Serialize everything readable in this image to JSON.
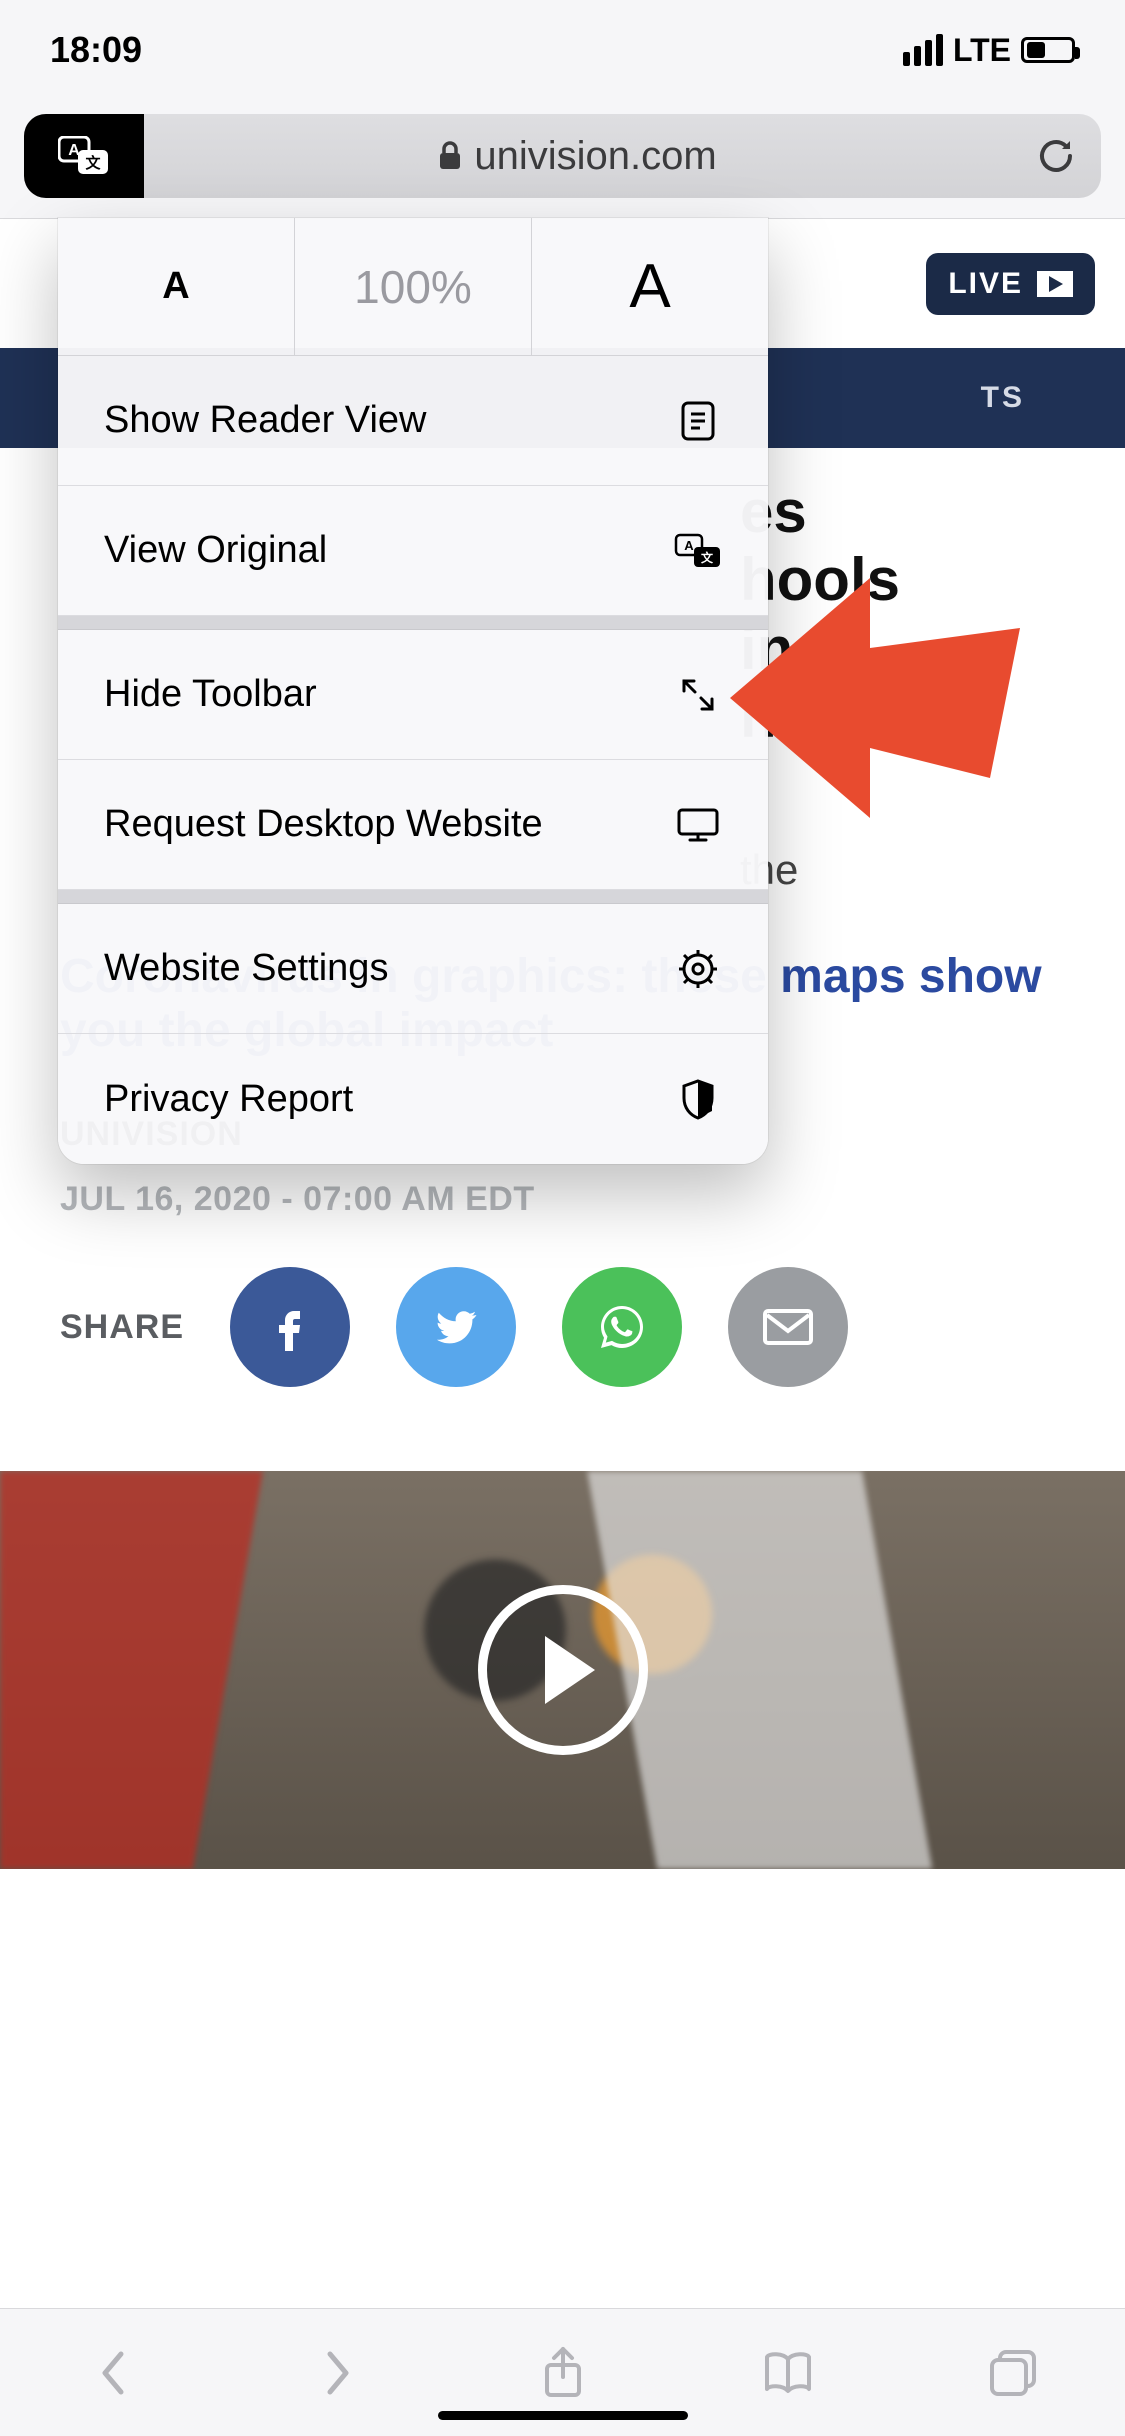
{
  "statusbar": {
    "time": "18:09",
    "network": "LTE"
  },
  "addressbar": {
    "domain": "univision.com"
  },
  "menu": {
    "zoom_pct": "100%",
    "reader": "Show Reader View",
    "view_original": "View Original",
    "hide_toolbar": "Hide Toolbar",
    "request_desktop": "Request Desktop Website",
    "website_settings": "Website Settings",
    "privacy_report": "Privacy Report"
  },
  "site": {
    "live_label": "LIVE",
    "nav_partial": "TS"
  },
  "article": {
    "headline_partial": "es\nhools\nin\nhe",
    "lede_partial": "the",
    "subhead": "Coronavirus in graphics: these maps show you the global impact",
    "byline": "UNIVISION",
    "dateline": "JUL 16, 2020 - 07:00 AM EDT",
    "share_label": "SHARE"
  }
}
